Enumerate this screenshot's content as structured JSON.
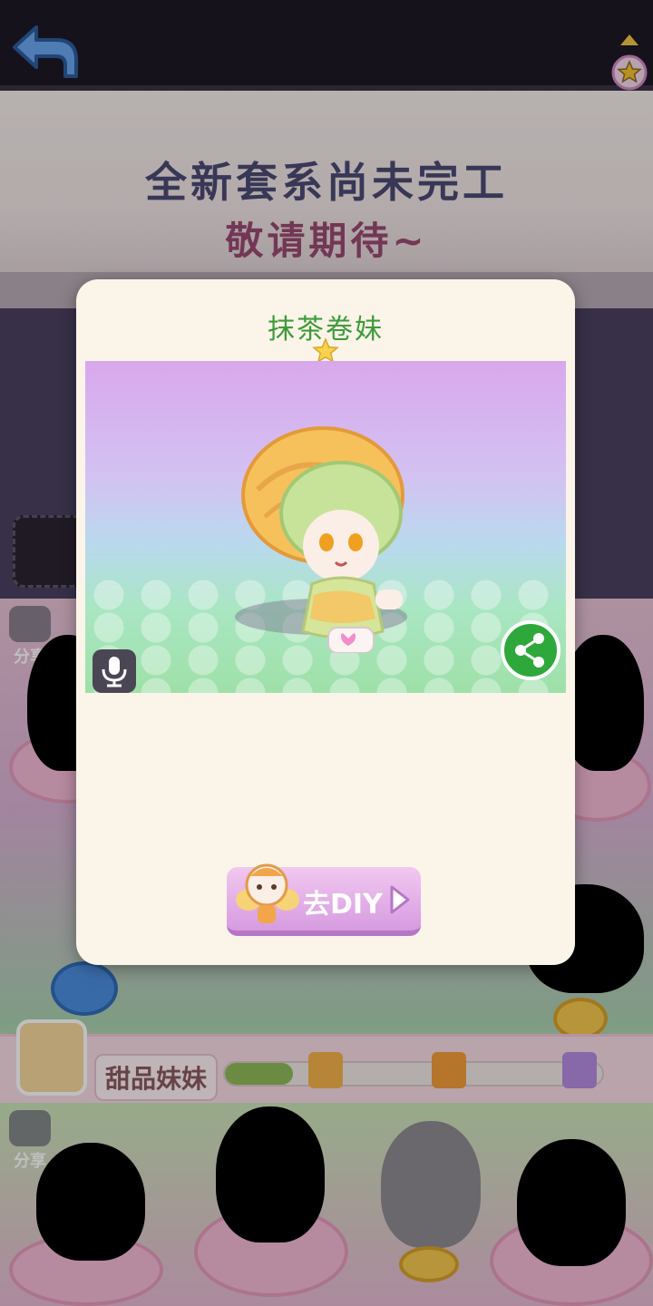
{
  "header": {
    "back_label": "退出"
  },
  "banner": {
    "line1": "全新套系尚未完工",
    "line2": "敬请期待~"
  },
  "gallery": {
    "share_label": "分享",
    "series_name": "甜品妹妹",
    "progress_fraction": 0.18
  },
  "modal": {
    "title": "抹茶卷妹",
    "diy_button_label": "去DIY"
  },
  "colors": {
    "modal_title": "#3f9b3a",
    "diy_button": "#d69be0",
    "share_button": "#2fa83b",
    "back_label": "#4a7fd6"
  },
  "icons": {
    "back": "back-arrow-icon",
    "star": "star-icon",
    "mic": "microphone-icon",
    "share": "share-icon",
    "camera": "camera-icon",
    "gift": "gift-icon",
    "play": "play-arrow-icon"
  }
}
